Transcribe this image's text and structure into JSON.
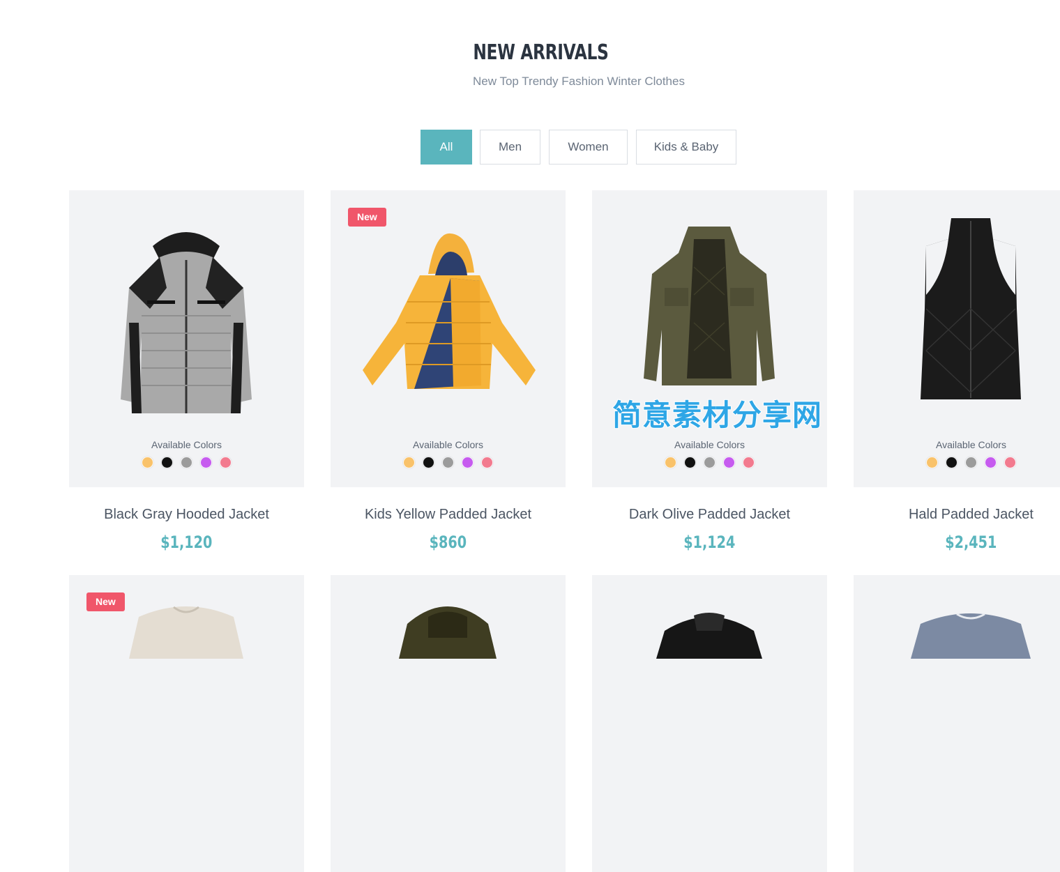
{
  "section": {
    "title": "NEW ARRIVALS",
    "subtitle": "New Top Trendy Fashion Winter Clothes"
  },
  "filters": [
    {
      "label": "All",
      "active": true
    },
    {
      "label": "Men",
      "active": false
    },
    {
      "label": "Women",
      "active": false
    },
    {
      "label": "Kids & Baby",
      "active": false
    }
  ],
  "colors": {
    "accent": "#5ab5bd",
    "badge": "#f0566a",
    "swatches": [
      "#f9c26a",
      "#111111",
      "#9b9b9b",
      "#c65bef",
      "#f27a8e"
    ]
  },
  "available_colors_label": "Available Colors",
  "products": [
    {
      "name": "Black Gray Hooded Jacket",
      "price": "$1,120",
      "badge": ""
    },
    {
      "name": "Kids Yellow Padded Jacket",
      "price": "$860",
      "badge": "New"
    },
    {
      "name": "Dark Olive Padded Jacket",
      "price": "$1,124",
      "badge": ""
    },
    {
      "name": "Hald Padded Jacket",
      "price": "$2,451",
      "badge": ""
    }
  ],
  "products_row2": [
    {
      "badge": "New"
    },
    {
      "badge": ""
    },
    {
      "badge": ""
    },
    {
      "badge": ""
    }
  ],
  "watermark": "简意素材分享网"
}
